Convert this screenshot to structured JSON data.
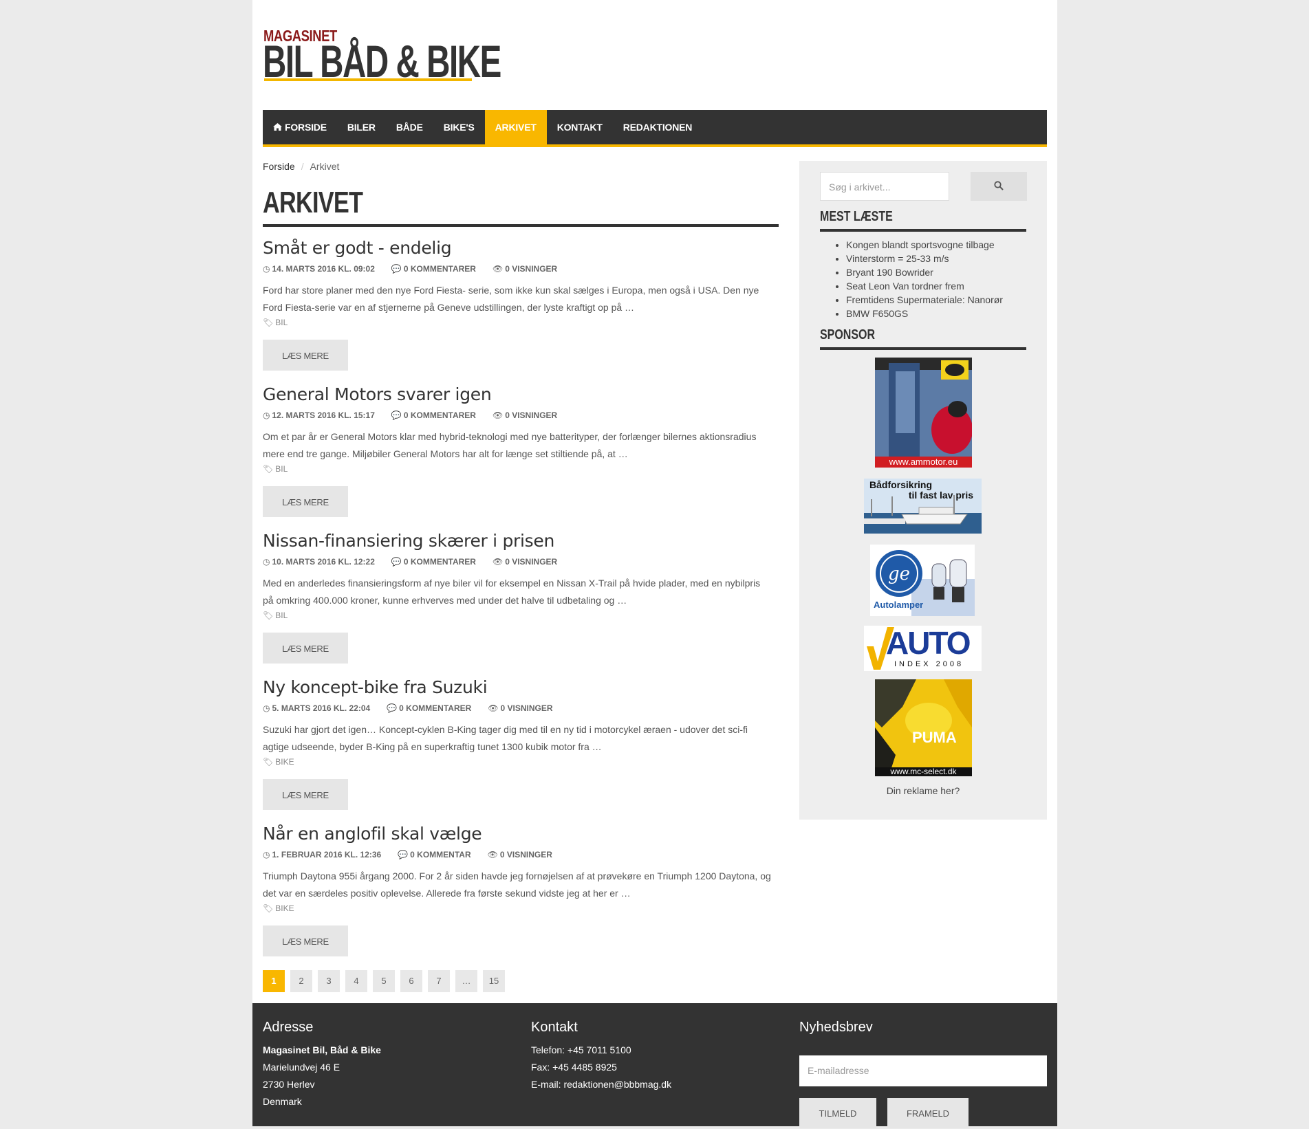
{
  "logo": {
    "small": "MAGASINET",
    "big": "BIL BÅD & BIKE"
  },
  "nav": {
    "items": [
      {
        "label": "FORSIDE",
        "icon": "home-icon"
      },
      {
        "label": "BILER"
      },
      {
        "label": "BÅDE"
      },
      {
        "label": "BIKE'S"
      },
      {
        "label": "ARKIVET",
        "active": true
      },
      {
        "label": "KONTAKT"
      },
      {
        "label": "REDAKTIONEN"
      }
    ],
    "accent_color": "#f9b700",
    "bg_color": "#333333"
  },
  "breadcrumb": {
    "home": "Forside",
    "separator": "/",
    "current": "Arkivet"
  },
  "page_title": "ARKIVET",
  "posts": [
    {
      "title": "Småt er godt - endelig",
      "date": "14. MARTS 2016 KL. 09:02",
      "comments": "0 KOMMENTARER",
      "views": "0 VISNINGER",
      "excerpt": "Ford har store planer med den nye Ford Fiesta- serie, som ikke kun skal sælges i Europa, men også i USA. Den nye Ford Fiesta-serie var en af stjernerne på Geneve udstillingen, der lyste kraftigt op på …",
      "tag": "BIL",
      "read_more": "LÆS MERE"
    },
    {
      "title": "General Motors svarer igen",
      "date": "12. MARTS 2016 KL. 15:17",
      "comments": "0 KOMMENTARER",
      "views": "0 VISNINGER",
      "excerpt": "Om et par år er General Motors klar med hybrid-teknologi med nye batterityper, der forlænger bilernes aktionsradius mere end tre gange. Miljøbiler General Motors har alt for længe set stiltiende på, at …",
      "tag": "BIL",
      "read_more": "LÆS MERE"
    },
    {
      "title": "Nissan-finansiering skærer i prisen",
      "date": "10. MARTS 2016 KL. 12:22",
      "comments": "0 KOMMENTARER",
      "views": "0 VISNINGER",
      "excerpt": "Med en anderledes finansieringsform af nye biler vil for eksempel en Nissan X-Trail på hvide plader, med en nybilpris på omkring 400.000 kroner, kunne erhverves med under det halve til udbetaling og …",
      "tag": "BIL",
      "read_more": "LÆS MERE"
    },
    {
      "title": "Ny koncept-bike fra Suzuki",
      "date": "5. MARTS 2016 KL. 22:04",
      "comments": "0 KOMMENTARER",
      "views": "0 VISNINGER",
      "excerpt": "Suzuki har gjort det igen… Koncept-cyklen B-King tager dig med til en ny tid i motorcykel æraen - udover det sci-fi agtige udseende, byder B-King på en superkraftig tunet 1300 kubik motor fra …",
      "tag": "BIKE",
      "read_more": "LÆS MERE"
    },
    {
      "title": "Når en anglofil skal vælge",
      "date": "1. FEBRUAR 2016 KL. 12:36",
      "comments": "0 KOMMENTAR",
      "views": "0 VISNINGER",
      "excerpt": "Triumph Daytona 955i årgang 2000. For 2 år siden havde jeg fornøjelsen af at prøvekøre en Triumph 1200 Daytona, og det var en særdeles positiv oplevelse. Allerede fra første sekund vidste jeg at her er …",
      "tag": "BIKE",
      "read_more": "LÆS MERE"
    }
  ],
  "pagination": {
    "pages": [
      "1",
      "2",
      "3",
      "4",
      "5",
      "6",
      "7",
      "…",
      "15"
    ],
    "current": "1"
  },
  "sidebar": {
    "search_placeholder": "Søg i arkivet...",
    "most_read_heading": "MEST LÆSTE",
    "most_read": [
      "Kongen blandt sportsvogne tilbage",
      "Vinterstorm = 25-33 m/s",
      "Bryant 190 Bowrider",
      "Seat Leon Van tordner frem",
      "Fremtidens Supermateriale: Nanorør",
      "BMW F650GS"
    ],
    "sponsor_heading": "SPONSOR",
    "ads": {
      "ammotor": "www.ammotor.eu",
      "boat_line1": "Bådforsikring",
      "boat_line2": "til fast lav pris",
      "ge": "Autolamper",
      "auto_big": "AUTO",
      "auto_small": "INDEX 2008",
      "puma_brand": "PUMA",
      "puma_url": "www.mc-select.dk"
    },
    "ad_caption": "Din reklame her?"
  },
  "footer": {
    "address_heading": "Adresse",
    "address_lines": [
      "Magasinet Bil, Båd & Bike",
      "Marielundvej 46 E",
      "2730 Herlev",
      "Denmark"
    ],
    "contact_heading": "Kontakt",
    "contact_lines": [
      "Telefon: +45 7011 5100",
      "Fax: +45 4485 8925",
      "E-mail: redaktionen@bbbmag.dk"
    ],
    "newsletter_heading": "Nyhedsbrev",
    "email_placeholder": "E-mailadresse",
    "subscribe": "TILMELD",
    "unsubscribe": "FRAMELD"
  }
}
